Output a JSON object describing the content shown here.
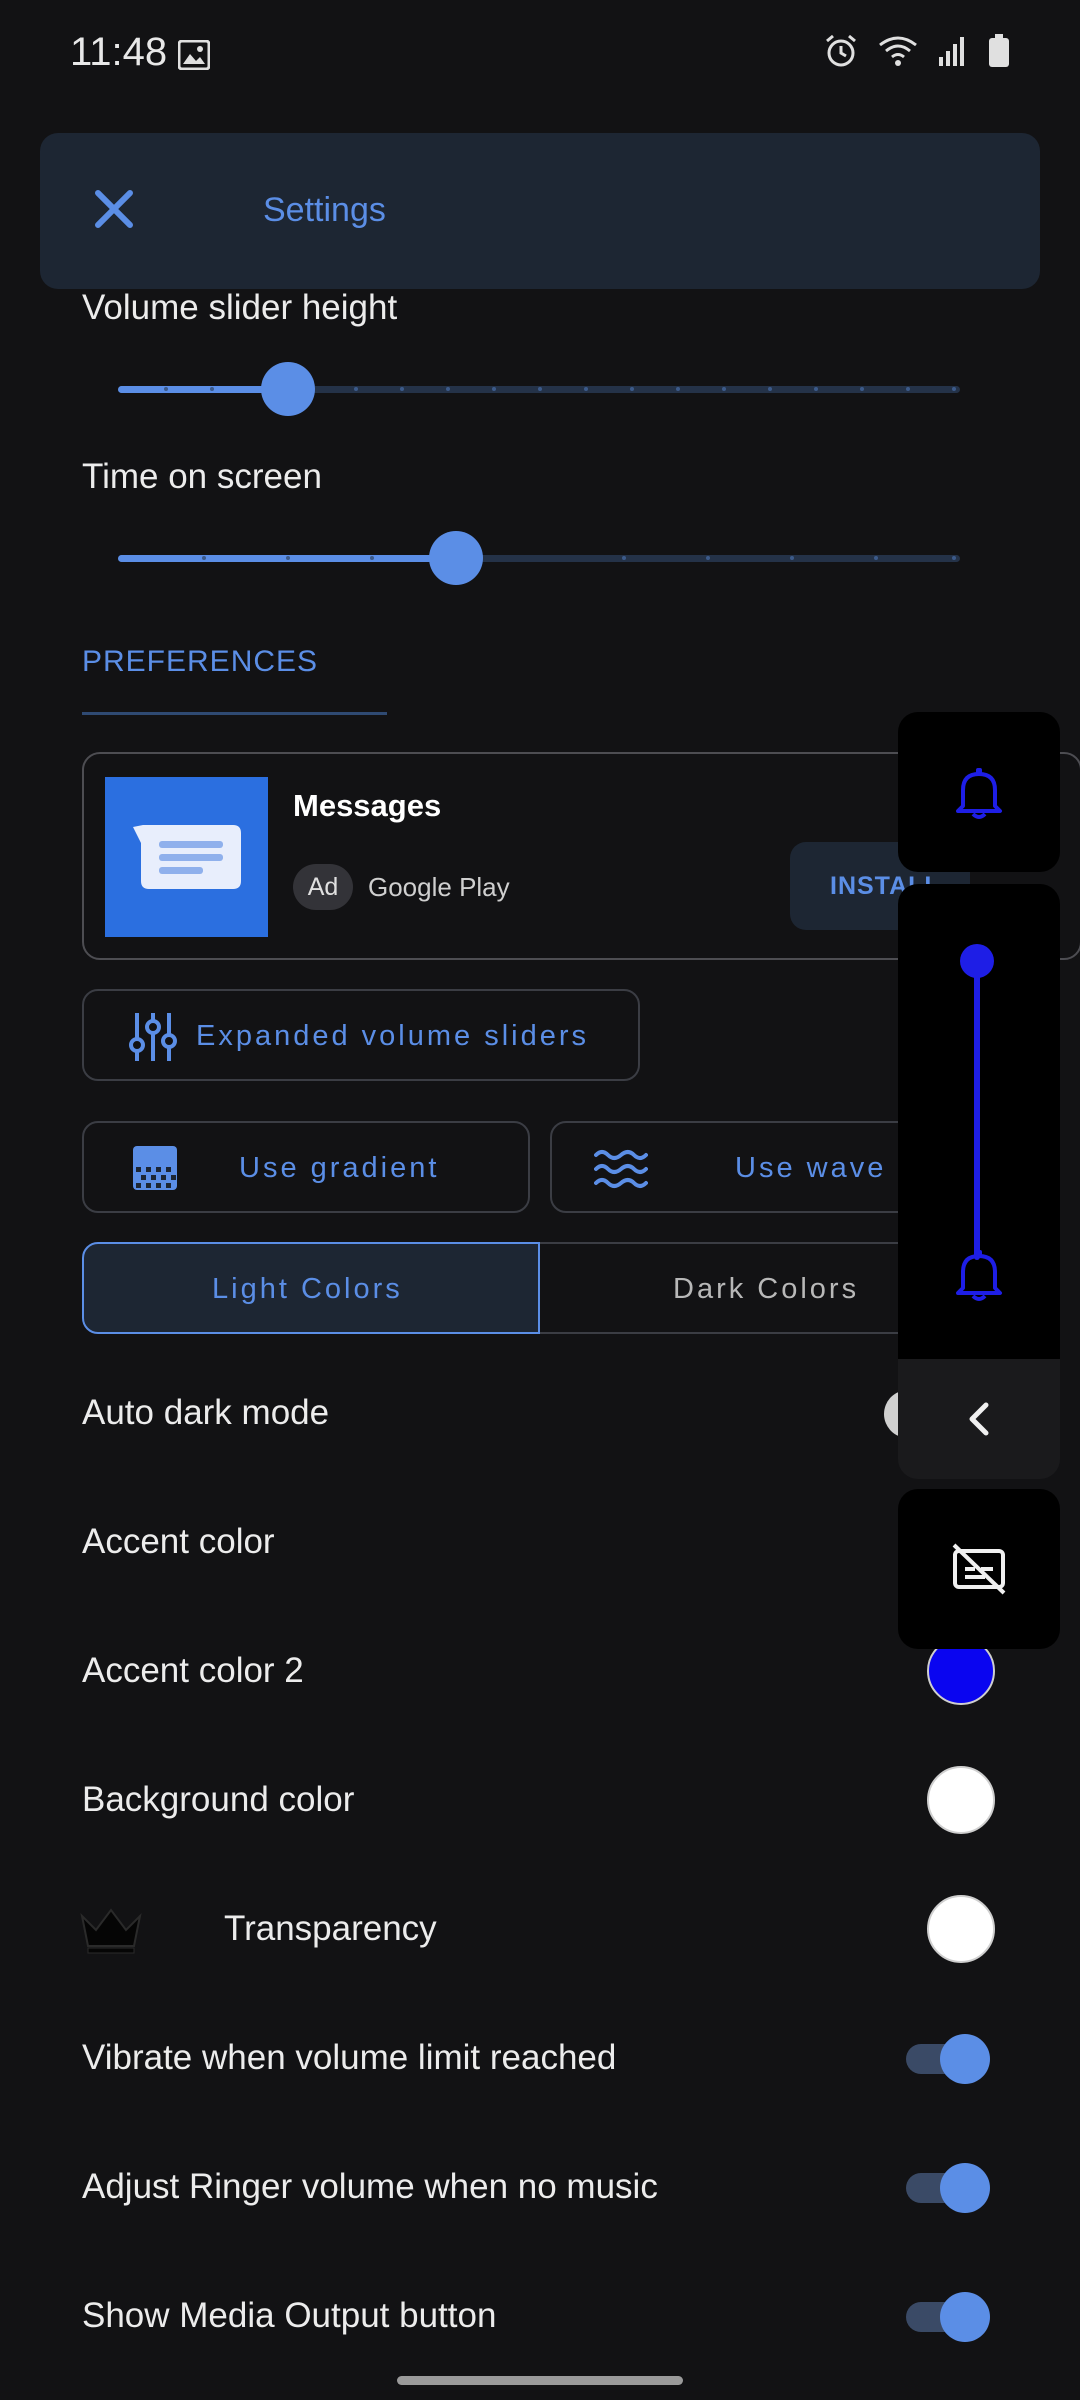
{
  "status_bar": {
    "time": "11:48"
  },
  "header": {
    "title": "Settings"
  },
  "sliders": [
    {
      "label": "Volume slider height",
      "value_fraction": 0.2
    },
    {
      "label": "Time on screen",
      "value_fraction": 0.4
    }
  ],
  "preferences": {
    "section_title": "PREFERENCES"
  },
  "ad": {
    "app_name": "Messages",
    "badge": "Ad",
    "source": "Google Play",
    "install_label": "INSTALL"
  },
  "buttons": {
    "expanded_sliders": "Expanded volume sliders",
    "use_gradient": "Use gradient",
    "use_wave": "Use wave"
  },
  "color_mode": {
    "options": [
      "Light Colors",
      "Dark Colors"
    ],
    "selected": "Light Colors"
  },
  "settings": {
    "auto_dark_mode": "Auto dark mode",
    "accent_color": "Accent color",
    "accent_color_2": "Accent color 2",
    "background_color": "Background color",
    "transparency": "Transparency",
    "vibrate": "Vibrate when volume limit reached",
    "adjust_ringer": "Adjust Ringer volume when no music",
    "media_output": "Show Media Output button"
  },
  "colors": {
    "accent": "#5b8ee6",
    "accent_color_2_swatch": "#0a05f0",
    "background_swatch": "#ffffff",
    "transparency_swatch": "#ffffff",
    "overlay_accent": "#1e1ee6"
  },
  "toggles": {
    "vibrate": true,
    "adjust_ringer": true,
    "media_output": true
  },
  "overlay_panel": {
    "volume_fraction": 1.0
  }
}
